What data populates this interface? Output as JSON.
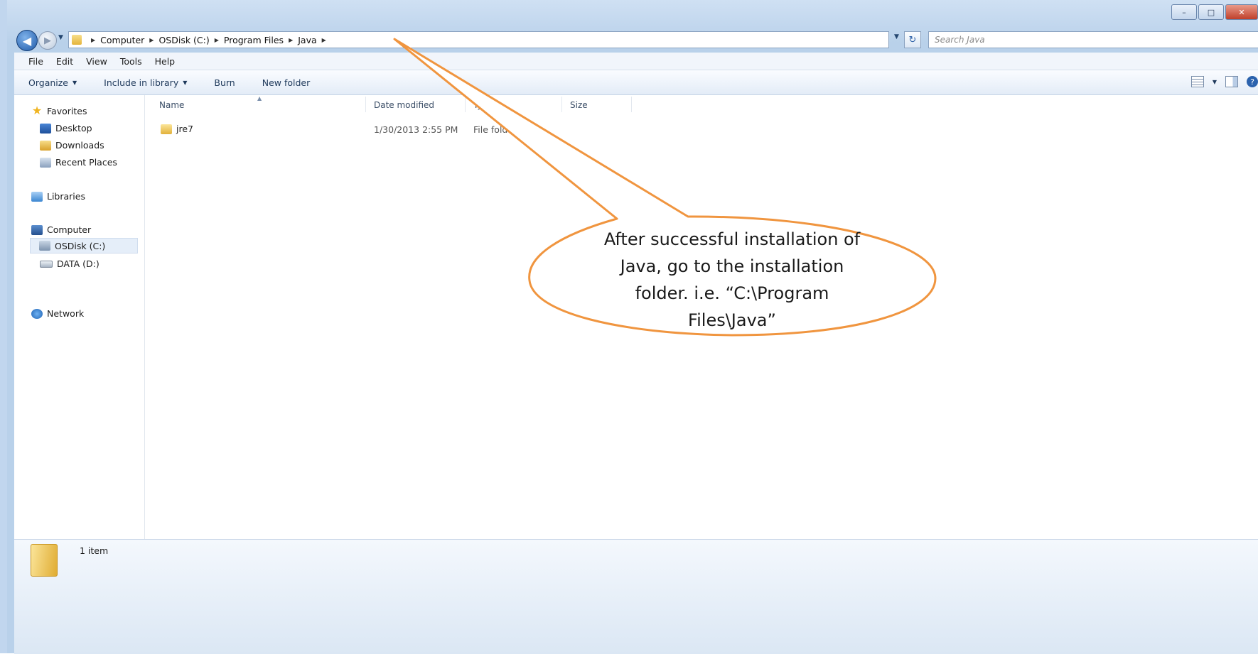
{
  "window": {
    "buttons": {
      "minimize": "–",
      "maximize": "□",
      "close": "✕"
    }
  },
  "address": {
    "crumbs": [
      "Computer",
      "OSDisk (C:)",
      "Program Files",
      "Java"
    ],
    "search_placeholder": "Search Java"
  },
  "menu": {
    "items": [
      "File",
      "Edit",
      "View",
      "Tools",
      "Help"
    ]
  },
  "toolbar": {
    "organize": "Organize",
    "include_in_library": "Include in library",
    "burn": "Burn",
    "new_folder": "New folder",
    "help_glyph": "?"
  },
  "sidebar": {
    "favorites": "Favorites",
    "desktop": "Desktop",
    "downloads": "Downloads",
    "recent_places": "Recent Places",
    "libraries": "Libraries",
    "computer": "Computer",
    "osdisk": "OSDisk (C:)",
    "data": "DATA (D:)",
    "network": "Network"
  },
  "columns": {
    "name": "Name",
    "date_modified": "Date modified",
    "type": "Ty",
    "size": "Size"
  },
  "files": [
    {
      "name": "jre7",
      "date": "1/30/2013 2:55 PM",
      "type": "File fold"
    }
  ],
  "status": {
    "count": "1 item"
  },
  "callout": {
    "lines": [
      "After successful installation of",
      "Java, go to the installation",
      "folder. i.e. “C:\\Program",
      "Files\\Java”"
    ]
  },
  "colors": {
    "callout_stroke": "#f0953f",
    "accent": "#2b62ad"
  }
}
